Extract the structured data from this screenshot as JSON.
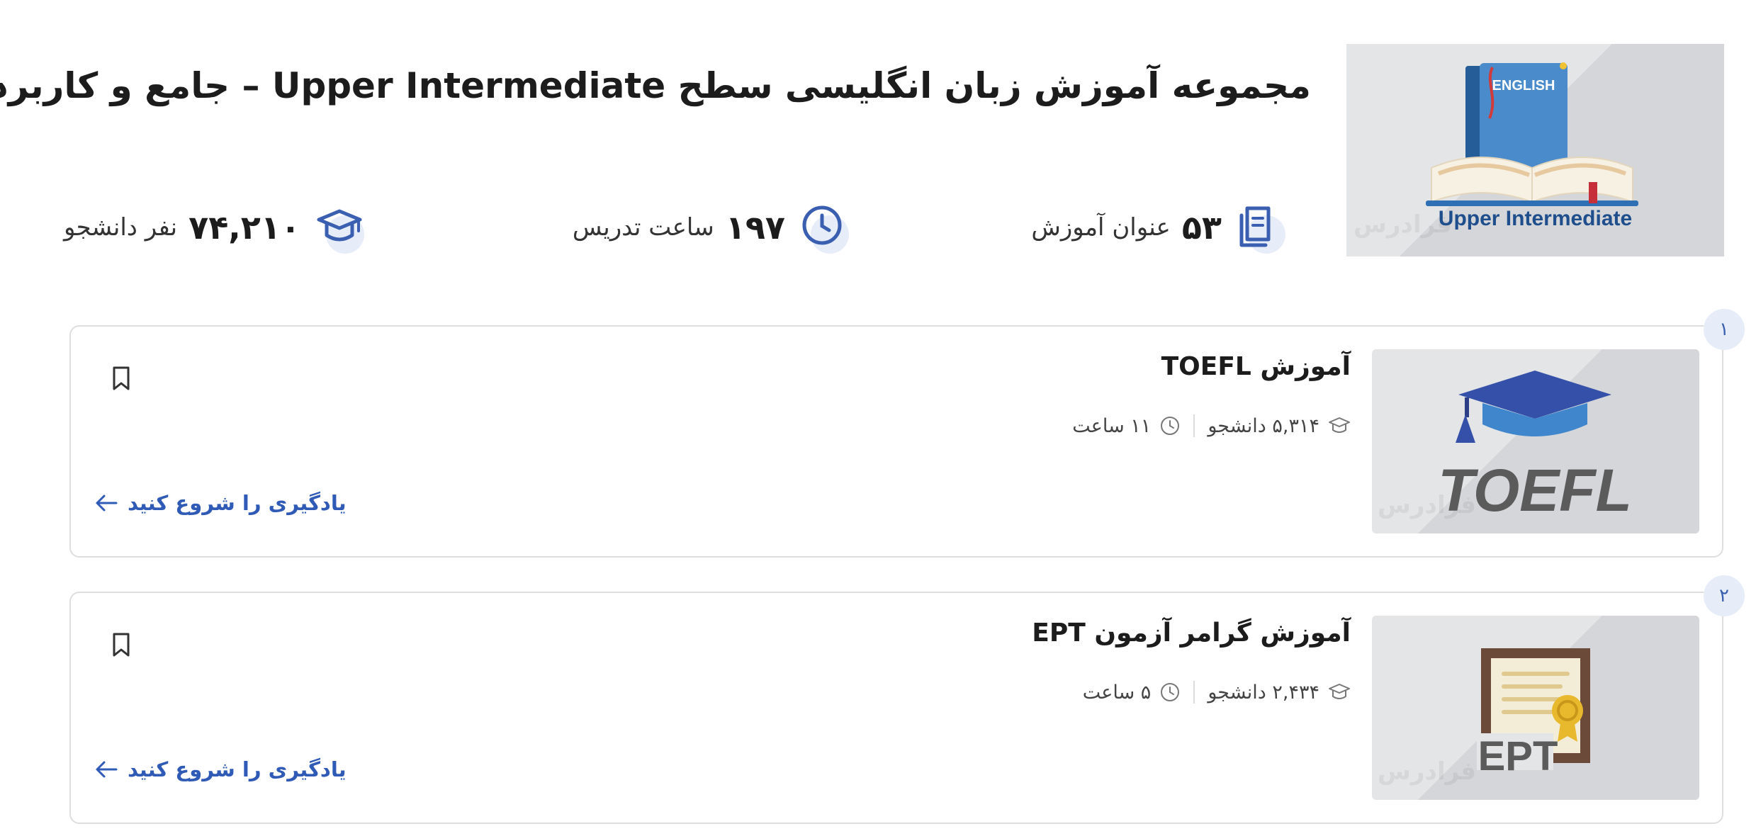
{
  "header": {
    "title": "مجموعه آموزش زبان انگلیسی سطح Upper Intermediate – جامع و کاربردی",
    "cover": {
      "caption": "Upper Intermediate",
      "book_label": "ENGLISH",
      "watermark": "فرادرس"
    },
    "stats": [
      {
        "icon": "document-icon",
        "number": "۵۳",
        "label": "عنوان آموزش"
      },
      {
        "icon": "clock-icon",
        "number": "۱۹۷",
        "label": "ساعت تدریس"
      },
      {
        "icon": "graduation-cap-icon",
        "number": "۷۴,۲۱۰",
        "label": "نفر دانشجو"
      }
    ]
  },
  "courses": [
    {
      "index": "۱",
      "title": "آموزش TOEFL",
      "students": "۵,۳۱۴ دانشجو",
      "hours": "۱۱ ساعت",
      "cta": "یادگیری را شروع کنید",
      "thumb_label": "TOEFL",
      "watermark": "فرادرس"
    },
    {
      "index": "۲",
      "title": "آموزش گرامر آزمون EPT",
      "students": "۲,۴۳۴ دانشجو",
      "hours": "۵ ساعت",
      "cta": "یادگیری را شروع کنید",
      "thumb_label": "EPT",
      "watermark": "فرادرس"
    }
  ],
  "colors": {
    "accent": "#2f5bb7",
    "icon_halo": "#e6ecf8",
    "card_border": "#dedede",
    "thumb_bg": "#e4e5e7"
  }
}
